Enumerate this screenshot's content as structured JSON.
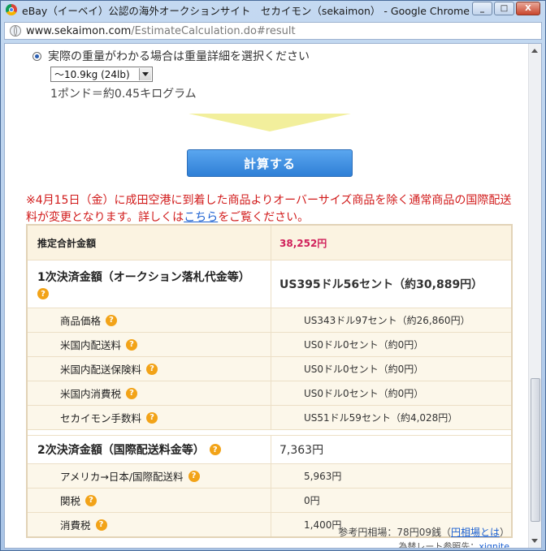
{
  "window": {
    "title": "eBay（イーベイ）公認の海外オークションサイト　セカイモン（sekaimon） - Google Chrome",
    "buttons": {
      "minimize": "_",
      "maximize": "□",
      "close": "X"
    }
  },
  "address": {
    "host": "www.sekaimon.com",
    "path": "/EstimateCalculation.do#result"
  },
  "weight": {
    "radio_label": "実際の重量がわかる場合は重量詳細を選択ください",
    "select_value": "〜10.9kg (24lb)",
    "conversion_note": "1ポンド＝約0.45キログラム"
  },
  "calculate_button": "計算する",
  "notice": {
    "text_before_link": "※4月15日（金）に成田空港に到着した商品よりオーバーサイズ商品を除く通常商品の国際配送料が変更となります。詳しくは",
    "link_text": "こちら",
    "text_after_link": "をご覧ください。"
  },
  "table": {
    "total": {
      "label": "推定合計金額",
      "value": "38,252円"
    },
    "first": {
      "label": "1次決済金額（オークション落札代金等）",
      "value": "US395ドル56セント（約30,889円）",
      "items": [
        {
          "label": "商品価格",
          "value": "US343ドル97セント（約26,860円）"
        },
        {
          "label": "米国内配送料",
          "value": "US0ドル0セント（約0円）"
        },
        {
          "label": "米国内配送保険料",
          "value": "US0ドル0セント（約0円）"
        },
        {
          "label": "米国内消費税",
          "value": "US0ドル0セント（約0円）"
        },
        {
          "label": "セカイモン手数料",
          "value": "US51ドル59セント（約4,028円）"
        }
      ]
    },
    "second": {
      "label": "2次決済金額（国際配送料金等）",
      "value": "7,363円",
      "items": [
        {
          "label": "アメリカ→日本/国際配送料",
          "value": "5,963円"
        },
        {
          "label": "関税",
          "value": "0円"
        },
        {
          "label": "消費税",
          "value": "1,400円"
        }
      ]
    },
    "help_glyph": "?"
  },
  "rate": {
    "text": "参考円相場：78円09銭（",
    "link": "円相場とは",
    "close": "）",
    "source_label": "為替レート参照先：",
    "source_link": "xignite"
  }
}
